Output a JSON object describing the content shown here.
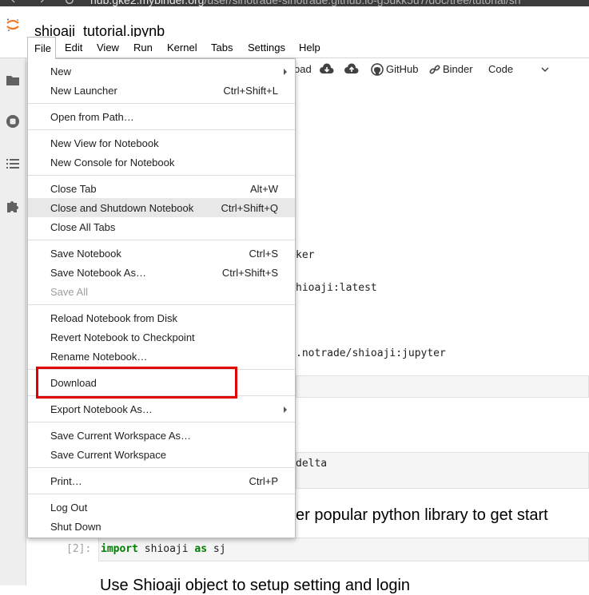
{
  "browser": {
    "back_glyph": "‹",
    "forward_glyph": "›",
    "reload_glyph": "↻",
    "url_host": "hub.gke2.mybinder.org",
    "url_path": "/user/sinotrade-sinotrade.github.io-g5ukk5u7/doc/tree/tutorial/sh"
  },
  "notebook": {
    "title": "shioaji_tutorial.ipynb"
  },
  "menubar": {
    "file": "File",
    "edit": "Edit",
    "view": "View",
    "run": "Run",
    "kernel": "Kernel",
    "tabs": "Tabs",
    "settings": "Settings",
    "help": "Help"
  },
  "toolbar": {
    "download_partial": "oad",
    "github": "GitHub",
    "binder": "Binder",
    "cell_type": "Code"
  },
  "file_menu": {
    "new": "New",
    "new_launcher": "New Launcher",
    "new_launcher_sc": "Ctrl+Shift+L",
    "open_from_path": "Open from Path…",
    "new_view": "New View for Notebook",
    "new_console": "New Console for Notebook",
    "close_tab": "Close Tab",
    "close_tab_sc": "Alt+W",
    "close_shutdown": "Close and Shutdown Notebook",
    "close_shutdown_sc": "Ctrl+Shift+Q",
    "close_all": "Close All Tabs",
    "save": "Save Notebook",
    "save_sc": "Ctrl+S",
    "save_as": "Save Notebook As…",
    "save_as_sc": "Ctrl+Shift+S",
    "save_all": "Save All",
    "reload": "Reload Notebook from Disk",
    "revert": "Revert Notebook to Checkpoint",
    "rename": "Rename Notebook…",
    "download": "Download",
    "export": "Export Notebook As…",
    "save_ws_as": "Save Current Workspace As…",
    "save_ws": "Save Current Workspace",
    "print": "Print…",
    "print_sc": "Ctrl+P",
    "logout": "Log Out",
    "shutdown": "Shut Down"
  },
  "content": {
    "line_ker": "ker",
    "line_shioaji_latest": "hioaji:latest",
    "line_jupyter": ".notrade/shioaji:jupyter",
    "line_delta": "delta",
    "heading_popular": "er popular python library to get start",
    "cell2_prompt": "[2]:",
    "cell2_import": "import",
    "cell2_module": " shioaji ",
    "cell2_as": "as",
    "cell2_alias": " sj",
    "heading_login": "Use Shioaji object to setup setting and login"
  },
  "colors": {
    "highlight": "#e00000",
    "keyword": "#008000",
    "jupyter_orange": "#f37726"
  },
  "icons": [
    "jupyter-logo-icon",
    "folder-icon",
    "stop-circle-icon",
    "list-icon",
    "puzzle-icon",
    "cloud-download-icon",
    "cloud-upload-icon",
    "github-icon",
    "link-icon",
    "chevron-down-icon",
    "submenu-arrow-icon"
  ]
}
